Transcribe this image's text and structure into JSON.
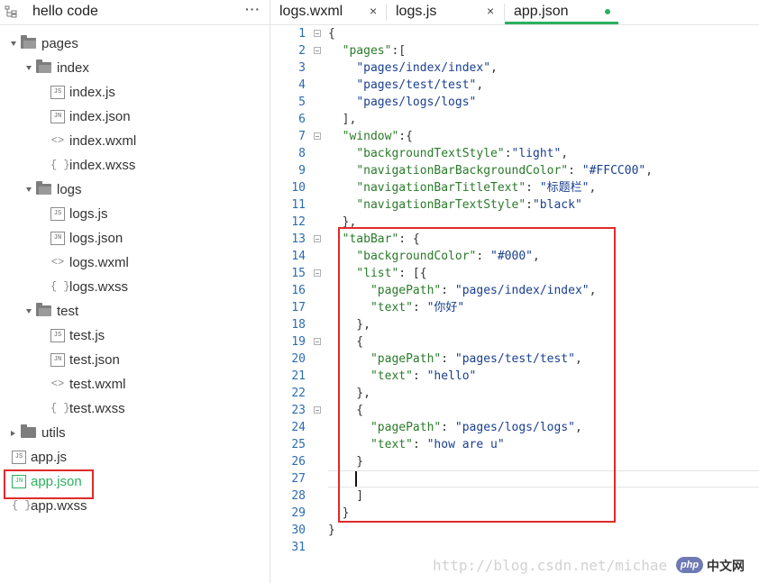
{
  "sidebar": {
    "title": "hello code",
    "more_label": "···",
    "tree": [
      {
        "label": "pages",
        "kind": "folder",
        "depth": 0,
        "expanded": true,
        "icon": "folder-open-icon"
      },
      {
        "label": "index",
        "kind": "folder",
        "depth": 1,
        "expanded": true,
        "icon": "folder-open-icon"
      },
      {
        "label": "index.js",
        "kind": "file",
        "depth": 2,
        "badge": "JS",
        "icon": "js-file-icon"
      },
      {
        "label": "index.json",
        "kind": "file",
        "depth": 2,
        "badge": "JN",
        "icon": "json-file-icon"
      },
      {
        "label": "index.wxml",
        "kind": "file",
        "depth": 2,
        "glyph": "<>",
        "icon": "wxml-file-icon"
      },
      {
        "label": "index.wxss",
        "kind": "file",
        "depth": 2,
        "glyph": "{ }",
        "icon": "wxss-file-icon"
      },
      {
        "label": "logs",
        "kind": "folder",
        "depth": 1,
        "expanded": true,
        "icon": "folder-open-icon"
      },
      {
        "label": "logs.js",
        "kind": "file",
        "depth": 2,
        "badge": "JS",
        "icon": "js-file-icon"
      },
      {
        "label": "logs.json",
        "kind": "file",
        "depth": 2,
        "badge": "JN",
        "icon": "json-file-icon"
      },
      {
        "label": "logs.wxml",
        "kind": "file",
        "depth": 2,
        "glyph": "<>",
        "icon": "wxml-file-icon"
      },
      {
        "label": "logs.wxss",
        "kind": "file",
        "depth": 2,
        "glyph": "{ }",
        "icon": "wxss-file-icon"
      },
      {
        "label": "test",
        "kind": "folder",
        "depth": 1,
        "expanded": true,
        "icon": "folder-open-icon"
      },
      {
        "label": "test.js",
        "kind": "file",
        "depth": 2,
        "badge": "JS",
        "icon": "js-file-icon"
      },
      {
        "label": "test.json",
        "kind": "file",
        "depth": 2,
        "badge": "JN",
        "icon": "json-file-icon"
      },
      {
        "label": "test.wxml",
        "kind": "file",
        "depth": 2,
        "glyph": "<>",
        "icon": "wxml-file-icon"
      },
      {
        "label": "test.wxss",
        "kind": "file",
        "depth": 2,
        "glyph": "{ }",
        "icon": "wxss-file-icon"
      },
      {
        "label": "utils",
        "kind": "folder",
        "depth": 0,
        "expanded": false,
        "icon": "folder-icon"
      },
      {
        "label": "app.js",
        "kind": "file",
        "depth": 0,
        "badge": "JS",
        "icon": "js-file-icon"
      },
      {
        "label": "app.json",
        "kind": "file",
        "depth": 0,
        "badge": "JN",
        "icon": "json-file-icon",
        "active": true
      },
      {
        "label": "app.wxss",
        "kind": "file",
        "depth": 0,
        "glyph": "{ }",
        "icon": "wxss-file-icon"
      }
    ]
  },
  "tabs": [
    {
      "label": "logs.wxml",
      "close": "×",
      "active": false
    },
    {
      "label": "logs.js",
      "close": "×",
      "active": false
    },
    {
      "label": "app.json",
      "active": true,
      "modified": true
    }
  ],
  "editor": {
    "current_line": 27,
    "lines": [
      {
        "n": "1",
        "fold": true,
        "tokens": [
          [
            "pun",
            "{"
          ]
        ]
      },
      {
        "n": "2",
        "fold": true,
        "tokens": [
          [
            "pun",
            "  "
          ],
          [
            "key",
            "\"pages\""
          ],
          [
            "pun",
            ":["
          ]
        ]
      },
      {
        "n": "3",
        "tokens": [
          [
            "pun",
            "    "
          ],
          [
            "str",
            "\"pages/index/index\""
          ],
          [
            "pun",
            ","
          ]
        ]
      },
      {
        "n": "4",
        "tokens": [
          [
            "pun",
            "    "
          ],
          [
            "str",
            "\"pages/test/test\""
          ],
          [
            "pun",
            ","
          ]
        ]
      },
      {
        "n": "5",
        "tokens": [
          [
            "pun",
            "    "
          ],
          [
            "str",
            "\"pages/logs/logs\""
          ]
        ]
      },
      {
        "n": "6",
        "tokens": [
          [
            "pun",
            "  ],"
          ]
        ]
      },
      {
        "n": "7",
        "fold": true,
        "tokens": [
          [
            "pun",
            "  "
          ],
          [
            "key",
            "\"window\""
          ],
          [
            "pun",
            ":{"
          ]
        ]
      },
      {
        "n": "8",
        "tokens": [
          [
            "pun",
            "    "
          ],
          [
            "key",
            "\"backgroundTextStyle\""
          ],
          [
            "pun",
            ":"
          ],
          [
            "str",
            "\"light\""
          ],
          [
            "pun",
            ","
          ]
        ]
      },
      {
        "n": "9",
        "tokens": [
          [
            "pun",
            "    "
          ],
          [
            "key",
            "\"navigationBarBackgroundColor\""
          ],
          [
            "pun",
            ": "
          ],
          [
            "str",
            "\"#FFCC00\""
          ],
          [
            "pun",
            ","
          ]
        ]
      },
      {
        "n": "10",
        "tokens": [
          [
            "pun",
            "    "
          ],
          [
            "key",
            "\"navigationBarTitleText\""
          ],
          [
            "pun",
            ": "
          ],
          [
            "str",
            "\"标题栏\""
          ],
          [
            "pun",
            ","
          ]
        ]
      },
      {
        "n": "11",
        "tokens": [
          [
            "pun",
            "    "
          ],
          [
            "key",
            "\"navigationBarTextStyle\""
          ],
          [
            "pun",
            ":"
          ],
          [
            "str",
            "\"black\""
          ]
        ]
      },
      {
        "n": "12",
        "tokens": [
          [
            "pun",
            "  },"
          ]
        ]
      },
      {
        "n": "13",
        "fold": true,
        "tokens": [
          [
            "pun",
            "  "
          ],
          [
            "key",
            "\"tabBar\""
          ],
          [
            "pun",
            ": {"
          ]
        ]
      },
      {
        "n": "14",
        "tokens": [
          [
            "pun",
            "    "
          ],
          [
            "key",
            "\"backgroundColor\""
          ],
          [
            "pun",
            ": "
          ],
          [
            "str",
            "\"#000\""
          ],
          [
            "pun",
            ","
          ]
        ]
      },
      {
        "n": "15",
        "fold": true,
        "tokens": [
          [
            "pun",
            "    "
          ],
          [
            "key",
            "\"list\""
          ],
          [
            "pun",
            ": [{"
          ]
        ]
      },
      {
        "n": "16",
        "tokens": [
          [
            "pun",
            "      "
          ],
          [
            "key",
            "\"pagePath\""
          ],
          [
            "pun",
            ": "
          ],
          [
            "str",
            "\"pages/index/index\""
          ],
          [
            "pun",
            ","
          ]
        ]
      },
      {
        "n": "17",
        "tokens": [
          [
            "pun",
            "      "
          ],
          [
            "key",
            "\"text\""
          ],
          [
            "pun",
            ": "
          ],
          [
            "str",
            "\"你好\""
          ]
        ]
      },
      {
        "n": "18",
        "tokens": [
          [
            "pun",
            "    },"
          ]
        ]
      },
      {
        "n": "19",
        "fold": true,
        "tokens": [
          [
            "pun",
            "    {"
          ]
        ]
      },
      {
        "n": "20",
        "tokens": [
          [
            "pun",
            "      "
          ],
          [
            "key",
            "\"pagePath\""
          ],
          [
            "pun",
            ": "
          ],
          [
            "str",
            "\"pages/test/test\""
          ],
          [
            "pun",
            ","
          ]
        ]
      },
      {
        "n": "21",
        "tokens": [
          [
            "pun",
            "      "
          ],
          [
            "key",
            "\"text\""
          ],
          [
            "pun",
            ": "
          ],
          [
            "str",
            "\"hello\""
          ]
        ]
      },
      {
        "n": "22",
        "tokens": [
          [
            "pun",
            "    },"
          ]
        ]
      },
      {
        "n": "23",
        "fold": true,
        "tokens": [
          [
            "pun",
            "    {"
          ]
        ]
      },
      {
        "n": "24",
        "tokens": [
          [
            "pun",
            "      "
          ],
          [
            "key",
            "\"pagePath\""
          ],
          [
            "pun",
            ": "
          ],
          [
            "str",
            "\"pages/logs/logs\""
          ],
          [
            "pun",
            ","
          ]
        ]
      },
      {
        "n": "25",
        "tokens": [
          [
            "pun",
            "      "
          ],
          [
            "key",
            "\"text\""
          ],
          [
            "pun",
            ": "
          ],
          [
            "str",
            "\"how are u\""
          ]
        ]
      },
      {
        "n": "26",
        "tokens": [
          [
            "pun",
            "    }"
          ]
        ]
      },
      {
        "n": "27",
        "tokens": [
          [
            "pun",
            ""
          ]
        ]
      },
      {
        "n": "28",
        "tokens": [
          [
            "pun",
            "    ]"
          ]
        ]
      },
      {
        "n": "29",
        "tokens": [
          [
            "pun",
            "  }"
          ]
        ]
      },
      {
        "n": "30",
        "tokens": [
          [
            "pun",
            "}"
          ]
        ]
      },
      {
        "n": "31",
        "tokens": [
          [
            "pun",
            ""
          ]
        ]
      }
    ]
  },
  "watermark": {
    "text": "http://blog.csdn.net/michae",
    "logo_text": "php",
    "site_text": "中文网"
  },
  "colors": {
    "accent": "#2bb05e",
    "highlight_box": "#e02a2a",
    "line_number": "#2b6cb0",
    "key": "#2a7a2a",
    "string": "#1a3f8f"
  }
}
